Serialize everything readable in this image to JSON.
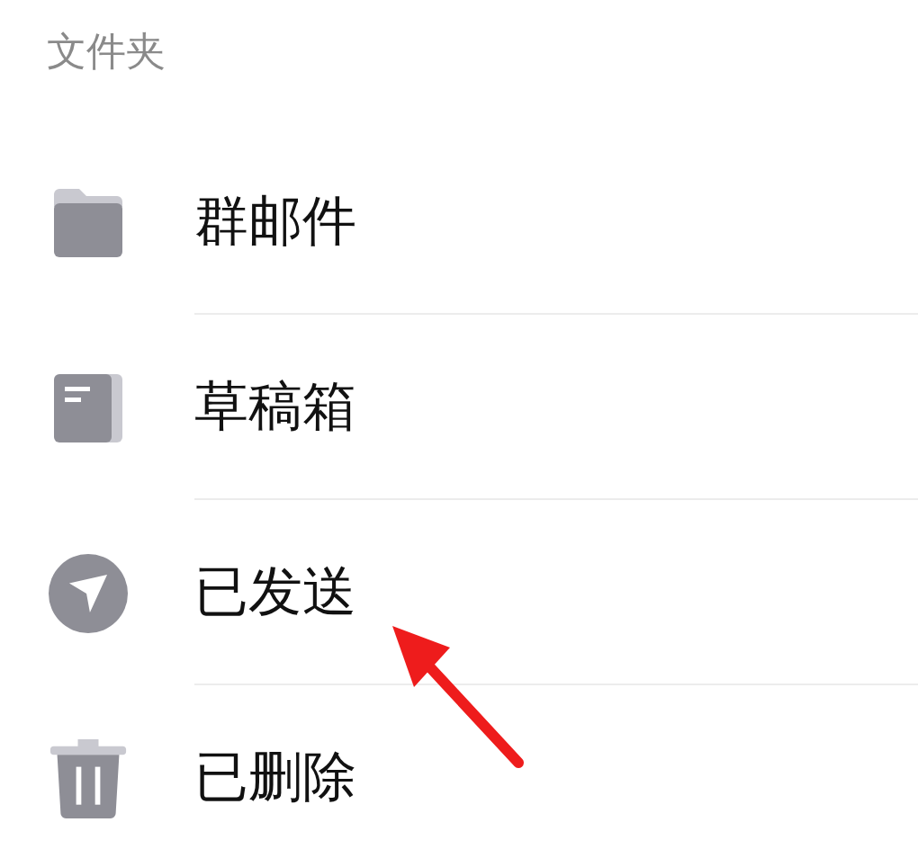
{
  "section_title": "文件夹",
  "folders": [
    {
      "kind": "folder",
      "label": "群邮件"
    },
    {
      "kind": "drafts",
      "label": "草稿箱"
    },
    {
      "kind": "sent",
      "label": "已发送"
    },
    {
      "kind": "trash",
      "label": "已删除"
    }
  ],
  "annotation": {
    "kind": "arrow"
  }
}
